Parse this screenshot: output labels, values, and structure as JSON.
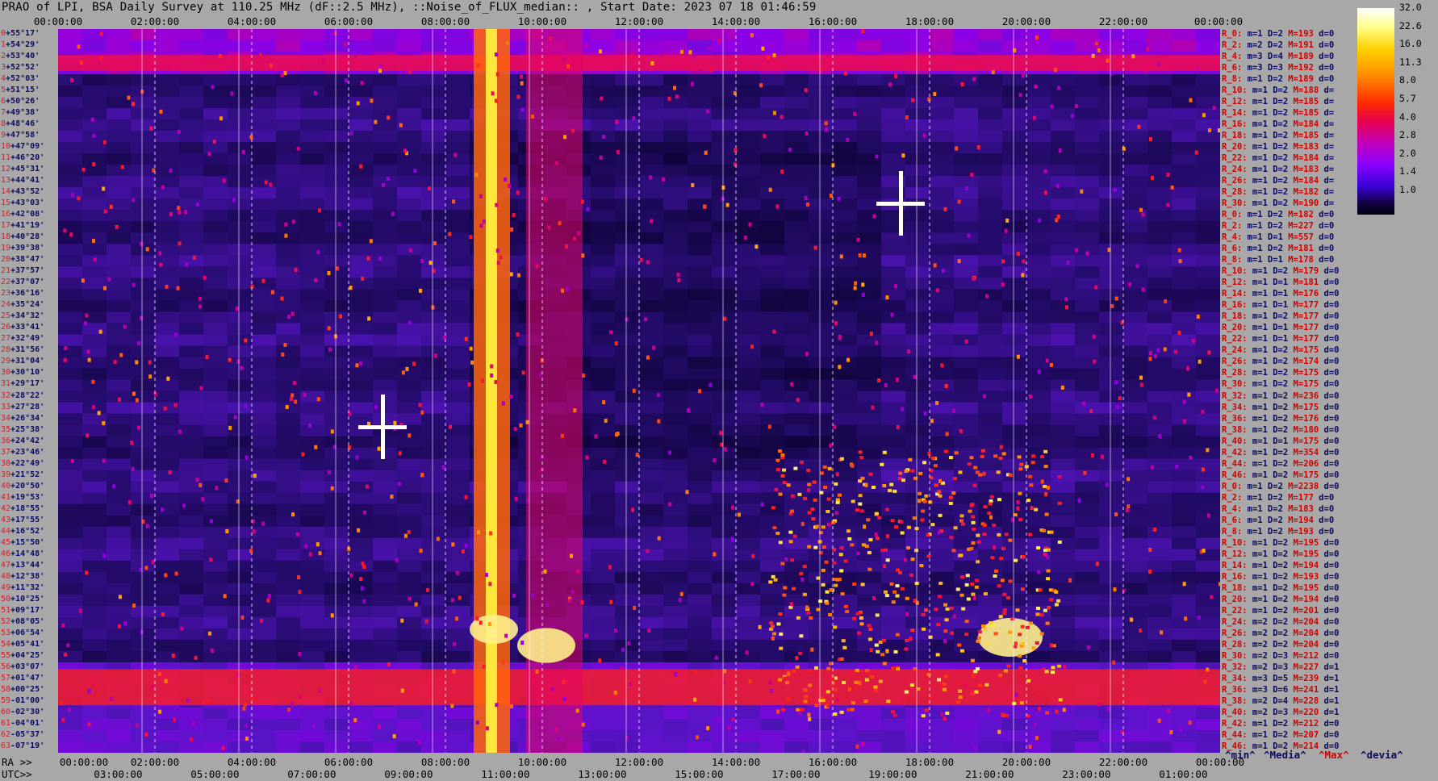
{
  "title": "PRAO of LPI, BSA Daily Survey at 110.25 MHz (dF::2.5 MHz), ::Noise_of_FLUX_median:: , Start Date: 2023 07 18 01:46:59",
  "footer": {
    "ra_prefix": "RA >>",
    "utc_prefix": "UTC>>",
    "legend_min": "^min^",
    "legend_median": "^Media^",
    "legend_max": "^Max^",
    "legend_devia": "^devia^"
  },
  "colorbar": {
    "ticks": [
      "32.0",
      "22.6",
      "16.0",
      "11.3",
      "8.0",
      "5.7",
      "4.0",
      "2.8",
      "2.0",
      "1.4",
      "1.0"
    ]
  },
  "chart_data": {
    "type": "heatmap",
    "title": "PRAO of LPI, BSA Daily Survey at 110.25 MHz (dF::2.5 MHz), ::Noise_of_FLUX_median:: , Start Date: 2023 07 18 01:46:59",
    "x_top_ticks": [
      "00:00:00",
      "02:00:00",
      "04:00:00",
      "06:00:00",
      "08:00:00",
      "10:00:00",
      "12:00:00",
      "14:00:00",
      "16:00:00",
      "18:00:00",
      "20:00:00",
      "22:00:00",
      "00:00:00"
    ],
    "x_bottom_ra_ticks": [
      "00:00:00",
      "02:00:00",
      "04:00:00",
      "06:00:00",
      "08:00:00",
      "10:00:00",
      "12:00:00",
      "14:00:00",
      "16:00:00",
      "18:00:00",
      "20:00:00",
      "22:00:00",
      "00:00:00"
    ],
    "x_bottom_utc_ticks": [
      "03:00:00",
      "05:00:00",
      "07:00:00",
      "09:00:00",
      "11:00:00",
      "13:00:00",
      "15:00:00",
      "17:00:00",
      "19:00:00",
      "21:00:00",
      "23:00:00",
      "01:00:00"
    ],
    "y_labels": [
      {
        "idx": "0",
        "dec": "+55°17'"
      },
      {
        "idx": "1",
        "dec": "+54°29'"
      },
      {
        "idx": "2",
        "dec": "+53°40'"
      },
      {
        "idx": "3",
        "dec": "+52°52'"
      },
      {
        "idx": "4",
        "dec": "+52°03'"
      },
      {
        "idx": "5",
        "dec": "+51°15'"
      },
      {
        "idx": "6",
        "dec": "+50°26'"
      },
      {
        "idx": "7",
        "dec": "+49°38'"
      },
      {
        "idx": "8",
        "dec": "+48°46'"
      },
      {
        "idx": "9",
        "dec": "+47°58'"
      },
      {
        "idx": "10",
        "dec": "+47°09'"
      },
      {
        "idx": "11",
        "dec": "+46°20'"
      },
      {
        "idx": "12",
        "dec": "+45°31'"
      },
      {
        "idx": "13",
        "dec": "+44°41'"
      },
      {
        "idx": "14",
        "dec": "+43°52'"
      },
      {
        "idx": "15",
        "dec": "+43°03'"
      },
      {
        "idx": "16",
        "dec": "+42°08'"
      },
      {
        "idx": "17",
        "dec": "+41°19'"
      },
      {
        "idx": "18",
        "dec": "+40°28'"
      },
      {
        "idx": "19",
        "dec": "+39°38'"
      },
      {
        "idx": "20",
        "dec": "+38°47'"
      },
      {
        "idx": "21",
        "dec": "+37°57'"
      },
      {
        "idx": "22",
        "dec": "+37°07'"
      },
      {
        "idx": "23",
        "dec": "+36°16'"
      },
      {
        "idx": "24",
        "dec": "+35°24'"
      },
      {
        "idx": "25",
        "dec": "+34°32'"
      },
      {
        "idx": "26",
        "dec": "+33°41'"
      },
      {
        "idx": "27",
        "dec": "+32°49'"
      },
      {
        "idx": "28",
        "dec": "+31°56'"
      },
      {
        "idx": "29",
        "dec": "+31°04'"
      },
      {
        "idx": "30",
        "dec": "+30°10'"
      },
      {
        "idx": "31",
        "dec": "+29°17'"
      },
      {
        "idx": "32",
        "dec": "+28°22'"
      },
      {
        "idx": "33",
        "dec": "+27°28'"
      },
      {
        "idx": "34",
        "dec": "+26°34'"
      },
      {
        "idx": "35",
        "dec": "+25°38'"
      },
      {
        "idx": "36",
        "dec": "+24°42'"
      },
      {
        "idx": "37",
        "dec": "+23°46'"
      },
      {
        "idx": "38",
        "dec": "+22°49'"
      },
      {
        "idx": "39",
        "dec": "+21°52'"
      },
      {
        "idx": "40",
        "dec": "+20°50'"
      },
      {
        "idx": "41",
        "dec": "+19°53'"
      },
      {
        "idx": "42",
        "dec": "+18°55'"
      },
      {
        "idx": "43",
        "dec": "+17°55'"
      },
      {
        "idx": "44",
        "dec": "+16°52'"
      },
      {
        "idx": "45",
        "dec": "+15°50'"
      },
      {
        "idx": "46",
        "dec": "+14°48'"
      },
      {
        "idx": "47",
        "dec": "+13°44'"
      },
      {
        "idx": "48",
        "dec": "+12°38'"
      },
      {
        "idx": "49",
        "dec": "+11°32'"
      },
      {
        "idx": "50",
        "dec": "+10°25'"
      },
      {
        "idx": "51",
        "dec": "+09°17'"
      },
      {
        "idx": "52",
        "dec": "+08°05'"
      },
      {
        "idx": "53",
        "dec": "+06°54'"
      },
      {
        "idx": "54",
        "dec": "+05°41'"
      },
      {
        "idx": "55",
        "dec": "+04°25'"
      },
      {
        "idx": "56",
        "dec": "+03°07'"
      },
      {
        "idx": "57",
        "dec": "+01°47'"
      },
      {
        "idx": "58",
        "dec": "+00°25'"
      },
      {
        "idx": "59",
        "dec": "-01°00'"
      },
      {
        "idx": "60",
        "dec": "-02°30'"
      },
      {
        "idx": "61",
        "dec": "-04°01'"
      },
      {
        "idx": "62",
        "dec": "-05°37'"
      },
      {
        "idx": "63",
        "dec": "-07°19'"
      }
    ],
    "stats_rows": [
      {
        "r": "R_0:",
        "m": "1",
        "D": "2",
        "M": "193",
        "d": "0"
      },
      {
        "r": "R_2:",
        "m": "2",
        "D": "2",
        "M": "191",
        "d": "0"
      },
      {
        "r": "R_4:",
        "m": "3",
        "D": "4",
        "M": "189",
        "d": "0"
      },
      {
        "r": "R_6:",
        "m": "3",
        "D": "3",
        "M": "192",
        "d": "0"
      },
      {
        "r": "R_8:",
        "m": "1",
        "D": "2",
        "M": "189",
        "d": "0"
      },
      {
        "r": "R_10:",
        "m": "1",
        "D": "2",
        "M": "188",
        "d": ""
      },
      {
        "r": "R_12:",
        "m": "1",
        "D": "2",
        "M": "185",
        "d": ""
      },
      {
        "r": "R_14:",
        "m": "1",
        "D": "2",
        "M": "185",
        "d": ""
      },
      {
        "r": "R_16:",
        "m": "1",
        "D": "2",
        "M": "184",
        "d": ""
      },
      {
        "r": "R_18:",
        "m": "1",
        "D": "2",
        "M": "185",
        "d": ""
      },
      {
        "r": "R_20:",
        "m": "1",
        "D": "2",
        "M": "183",
        "d": ""
      },
      {
        "r": "R_22:",
        "m": "1",
        "D": "2",
        "M": "184",
        "d": ""
      },
      {
        "r": "R_24:",
        "m": "1",
        "D": "2",
        "M": "183",
        "d": ""
      },
      {
        "r": "R_26:",
        "m": "1",
        "D": "2",
        "M": "184",
        "d": ""
      },
      {
        "r": "R_28:",
        "m": "1",
        "D": "2",
        "M": "182",
        "d": ""
      },
      {
        "r": "R_30:",
        "m": "1",
        "D": "2",
        "M": "190",
        "d": ""
      },
      {
        "r": "R_0:",
        "m": "1",
        "D": "2",
        "M": "182",
        "d": "0"
      },
      {
        "r": "R_2:",
        "m": "1",
        "D": "2",
        "M": "227",
        "d": "0"
      },
      {
        "r": "R_4:",
        "m": "1",
        "D": "1",
        "M": "557",
        "d": "0"
      },
      {
        "r": "R_6:",
        "m": "1",
        "D": "2",
        "M": "181",
        "d": "0"
      },
      {
        "r": "R_8:",
        "m": "1",
        "D": "1",
        "M": "178",
        "d": "0"
      },
      {
        "r": "R_10:",
        "m": "1",
        "D": "2",
        "M": "179",
        "d": "0"
      },
      {
        "r": "R_12:",
        "m": "1",
        "D": "1",
        "M": "181",
        "d": "0"
      },
      {
        "r": "R_14:",
        "m": "1",
        "D": "1",
        "M": "176",
        "d": "0"
      },
      {
        "r": "R_16:",
        "m": "1",
        "D": "1",
        "M": "177",
        "d": "0"
      },
      {
        "r": "R_18:",
        "m": "1",
        "D": "2",
        "M": "177",
        "d": "0"
      },
      {
        "r": "R_20:",
        "m": "1",
        "D": "1",
        "M": "177",
        "d": "0"
      },
      {
        "r": "R_22:",
        "m": "1",
        "D": "1",
        "M": "177",
        "d": "0"
      },
      {
        "r": "R_24:",
        "m": "1",
        "D": "2",
        "M": "175",
        "d": "0"
      },
      {
        "r": "R_26:",
        "m": "1",
        "D": "2",
        "M": "174",
        "d": "0"
      },
      {
        "r": "R_28:",
        "m": "1",
        "D": "2",
        "M": "175",
        "d": "0"
      },
      {
        "r": "R_30:",
        "m": "1",
        "D": "2",
        "M": "175",
        "d": "0"
      },
      {
        "r": "R_32:",
        "m": "1",
        "D": "2",
        "M": "236",
        "d": "0"
      },
      {
        "r": "R_34:",
        "m": "1",
        "D": "2",
        "M": "175",
        "d": "0"
      },
      {
        "r": "R_36:",
        "m": "1",
        "D": "2",
        "M": "176",
        "d": "0"
      },
      {
        "r": "R_38:",
        "m": "1",
        "D": "2",
        "M": "180",
        "d": "0"
      },
      {
        "r": "R_40:",
        "m": "1",
        "D": "1",
        "M": "175",
        "d": "0"
      },
      {
        "r": "R_42:",
        "m": "1",
        "D": "2",
        "M": "354",
        "d": "0"
      },
      {
        "r": "R_44:",
        "m": "1",
        "D": "2",
        "M": "206",
        "d": "0"
      },
      {
        "r": "R_46:",
        "m": "1",
        "D": "2",
        "M": "175",
        "d": "0"
      },
      {
        "r": "R_0:",
        "m": "1",
        "D": "2",
        "M": "2238",
        "d": "0"
      },
      {
        "r": "R_2:",
        "m": "1",
        "D": "2",
        "M": "177",
        "d": "0"
      },
      {
        "r": "R_4:",
        "m": "1",
        "D": "2",
        "M": "183",
        "d": "0"
      },
      {
        "r": "R_6:",
        "m": "1",
        "D": "2",
        "M": "194",
        "d": "0"
      },
      {
        "r": "R_8:",
        "m": "1",
        "D": "2",
        "M": "193",
        "d": "0"
      },
      {
        "r": "R_10:",
        "m": "1",
        "D": "2",
        "M": "195",
        "d": "0"
      },
      {
        "r": "R_12:",
        "m": "1",
        "D": "2",
        "M": "195",
        "d": "0"
      },
      {
        "r": "R_14:",
        "m": "1",
        "D": "2",
        "M": "194",
        "d": "0"
      },
      {
        "r": "R_16:",
        "m": "1",
        "D": "2",
        "M": "193",
        "d": "0"
      },
      {
        "r": "R_18:",
        "m": "1",
        "D": "2",
        "M": "195",
        "d": "0"
      },
      {
        "r": "R_20:",
        "m": "1",
        "D": "2",
        "M": "194",
        "d": "0"
      },
      {
        "r": "R_22:",
        "m": "1",
        "D": "2",
        "M": "201",
        "d": "0"
      },
      {
        "r": "R_24:",
        "m": "2",
        "D": "2",
        "M": "204",
        "d": "0"
      },
      {
        "r": "R_26:",
        "m": "2",
        "D": "2",
        "M": "204",
        "d": "0"
      },
      {
        "r": "R_28:",
        "m": "2",
        "D": "2",
        "M": "204",
        "d": "0"
      },
      {
        "r": "R_30:",
        "m": "2",
        "D": "3",
        "M": "212",
        "d": "0"
      },
      {
        "r": "R_32:",
        "m": "2",
        "D": "3",
        "M": "227",
        "d": "1"
      },
      {
        "r": "R_34:",
        "m": "3",
        "D": "5",
        "M": "239",
        "d": "1"
      },
      {
        "r": "R_36:",
        "m": "3",
        "D": "6",
        "M": "241",
        "d": "1"
      },
      {
        "r": "R_38:",
        "m": "2",
        "D": "4",
        "M": "228",
        "d": "1"
      },
      {
        "r": "R_40:",
        "m": "2",
        "D": "3",
        "M": "220",
        "d": "1"
      },
      {
        "r": "R_42:",
        "m": "1",
        "D": "2",
        "M": "212",
        "d": "0"
      },
      {
        "r": "R_44:",
        "m": "1",
        "D": "2",
        "M": "207",
        "d": "0"
      },
      {
        "r": "R_46:",
        "m": "1",
        "D": "2",
        "M": "214",
        "d": "0"
      }
    ],
    "colorscale_range": [
      1.0,
      32.0
    ],
    "colors": {
      "low": "#0a0028",
      "mid": "#7a00e0",
      "high_mid": "#ff1e1e",
      "high": "#ffd000",
      "max": "#ffffff",
      "label_red": "#d40000",
      "label_navy": "#0a0a60"
    }
  }
}
